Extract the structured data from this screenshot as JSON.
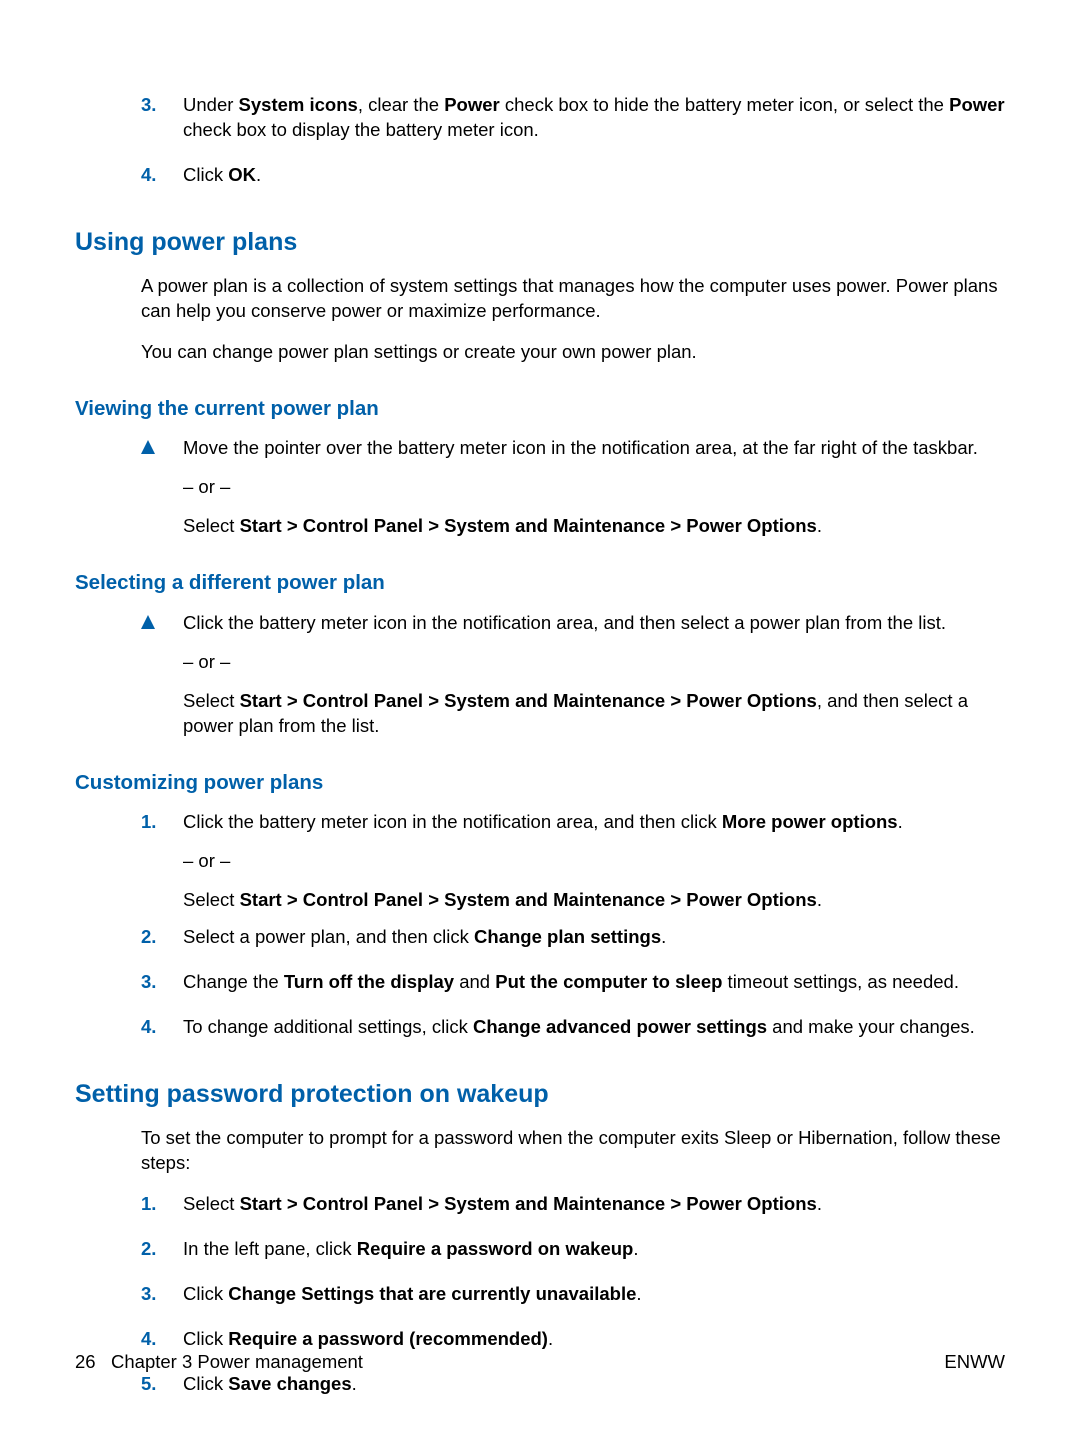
{
  "intro_steps": {
    "step3": {
      "num": "3.",
      "pre": "Under ",
      "b1": "System icons",
      "mid1": ", clear the ",
      "b2": "Power",
      "mid2": " check box to hide the battery meter icon, or select the ",
      "b3": "Power",
      "post": " check box to display the battery meter icon."
    },
    "step4": {
      "num": "4.",
      "pre": "Click ",
      "b1": "OK",
      "post": "."
    }
  },
  "h_using": "Using power plans",
  "using_p1": "A power plan is a collection of system settings that manages how the computer uses power. Power plans can help you conserve power or maximize performance.",
  "using_p2": "You can change power plan settings or create your own power plan.",
  "h_viewing": "Viewing the current power plan",
  "viewing": {
    "line1": "Move the pointer over the battery meter icon in the notification area, at the far right of the taskbar.",
    "or": "– or –",
    "line2_pre": "Select ",
    "line2_b": "Start > Control Panel > System and Maintenance > Power Options",
    "line2_post": "."
  },
  "h_selecting": "Selecting a different power plan",
  "selecting": {
    "line1": "Click the battery meter icon in the notification area, and then select a power plan from the list.",
    "or": "– or –",
    "line2_pre": "Select ",
    "line2_b": "Start > Control Panel > System and Maintenance > Power Options",
    "line2_post": ", and then select a power plan from the list."
  },
  "h_custom": "Customizing power plans",
  "custom": {
    "s1": {
      "num": "1.",
      "line1_pre": "Click the battery meter icon in the notification area, and then click ",
      "line1_b": "More power options",
      "line1_post": ".",
      "or": "– or –",
      "line2_pre": "Select ",
      "line2_b": "Start > Control Panel > System and Maintenance > Power Options",
      "line2_post": "."
    },
    "s2": {
      "num": "2.",
      "pre": "Select a power plan, and then click ",
      "b1": "Change plan settings",
      "post": "."
    },
    "s3": {
      "num": "3.",
      "pre": "Change the ",
      "b1": "Turn off the display",
      "mid": " and ",
      "b2": "Put the computer to sleep",
      "post": " timeout settings, as needed."
    },
    "s4": {
      "num": "4.",
      "pre": "To change additional settings, click ",
      "b1": "Change advanced power settings",
      "post": " and make your changes."
    }
  },
  "h_password": "Setting password protection on wakeup",
  "password_intro": "To set the computer to prompt for a password when the computer exits Sleep or Hibernation, follow these steps:",
  "pwd": {
    "s1": {
      "num": "1.",
      "pre": "Select ",
      "b1": "Start > Control Panel > System and Maintenance > Power Options",
      "post": "."
    },
    "s2": {
      "num": "2.",
      "pre": "In the left pane, click ",
      "b1": "Require a password on wakeup",
      "post": "."
    },
    "s3": {
      "num": "3.",
      "pre": "Click ",
      "b1": "Change Settings that are currently unavailable",
      "post": "."
    },
    "s4": {
      "num": "4.",
      "pre": "Click ",
      "b1": "Require a password (recommended)",
      "post": "."
    },
    "s5": {
      "num": "5.",
      "pre": "Click ",
      "b1": "Save changes",
      "post": "."
    }
  },
  "footer": {
    "page": "26",
    "chapter": "Chapter 3   Power management",
    "right": "ENWW"
  }
}
